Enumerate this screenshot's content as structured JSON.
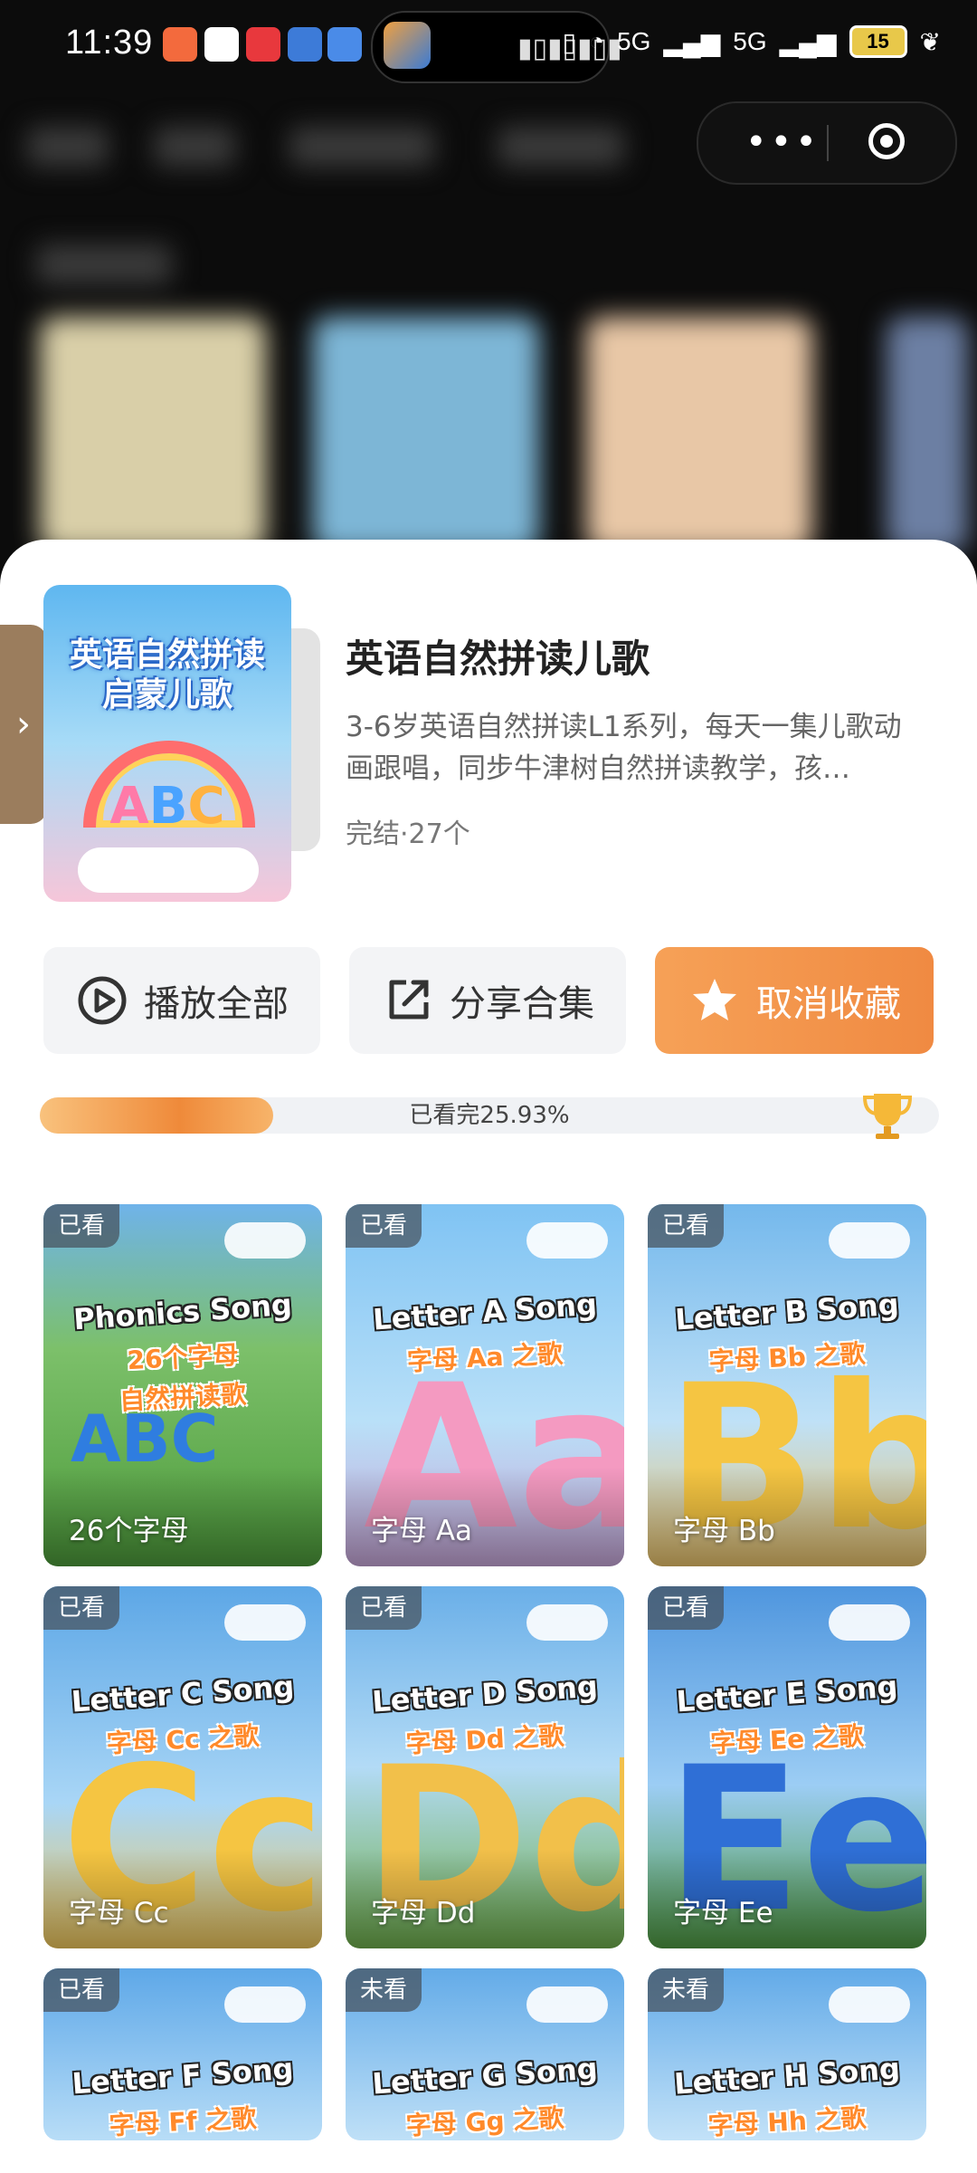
{
  "status_bar": {
    "time": "11:39",
    "network": "5G",
    "network2": "5G",
    "battery": "15"
  },
  "collection": {
    "title": "英语自然拼读儿歌",
    "description": "3-6岁英语自然拼读L1系列，每天一集儿歌动画跟唱，同步牛津树自然拼读教学，孩…",
    "meta": "完结·27个",
    "cover_title_line1": "英语自然拼读",
    "cover_title_line2": "启蒙儿歌",
    "cover_letters": [
      "A",
      "B",
      "C"
    ]
  },
  "actions": {
    "play_all": "播放全部",
    "share": "分享合集",
    "unfavorite": "取消收藏"
  },
  "progress": {
    "label": "已看完25.93%",
    "percent": 25.93
  },
  "episodes": [
    {
      "badge": "已看",
      "caption": "26个字母",
      "line1": "Phonics Song",
      "line2": "26个字母",
      "line3": "自然拼读歌",
      "letter": "ABC"
    },
    {
      "badge": "已看",
      "caption": "字母 Aa",
      "line1": "Letter A Song",
      "line2": "字母 Aa 之歌",
      "letter": "Aa"
    },
    {
      "badge": "已看",
      "caption": "字母 Bb",
      "line1": "Letter B Song",
      "line2": "字母 Bb 之歌",
      "letter": "Bb"
    },
    {
      "badge": "已看",
      "caption": "字母 Cc",
      "line1": "Letter C Song",
      "line2": "字母 Cc 之歌",
      "letter": "Cc"
    },
    {
      "badge": "已看",
      "caption": "字母 Dd",
      "line1": "Letter D Song",
      "line2": "字母 Dd 之歌",
      "letter": "Dd"
    },
    {
      "badge": "已看",
      "caption": "字母 Ee",
      "line1": "Letter E Song",
      "line2": "字母 Ee 之歌",
      "letter": "Ee"
    },
    {
      "badge": "已看",
      "caption": "",
      "line1": "Letter F Song",
      "line2": "字母 Ff 之歌",
      "letter": ""
    },
    {
      "badge": "未看",
      "caption": "",
      "line1": "Letter G Song",
      "line2": "字母 Gg 之歌",
      "letter": ""
    },
    {
      "badge": "未看",
      "caption": "",
      "line1": "Letter H Song",
      "line2": "字母 Hh 之歌",
      "letter": ""
    }
  ]
}
